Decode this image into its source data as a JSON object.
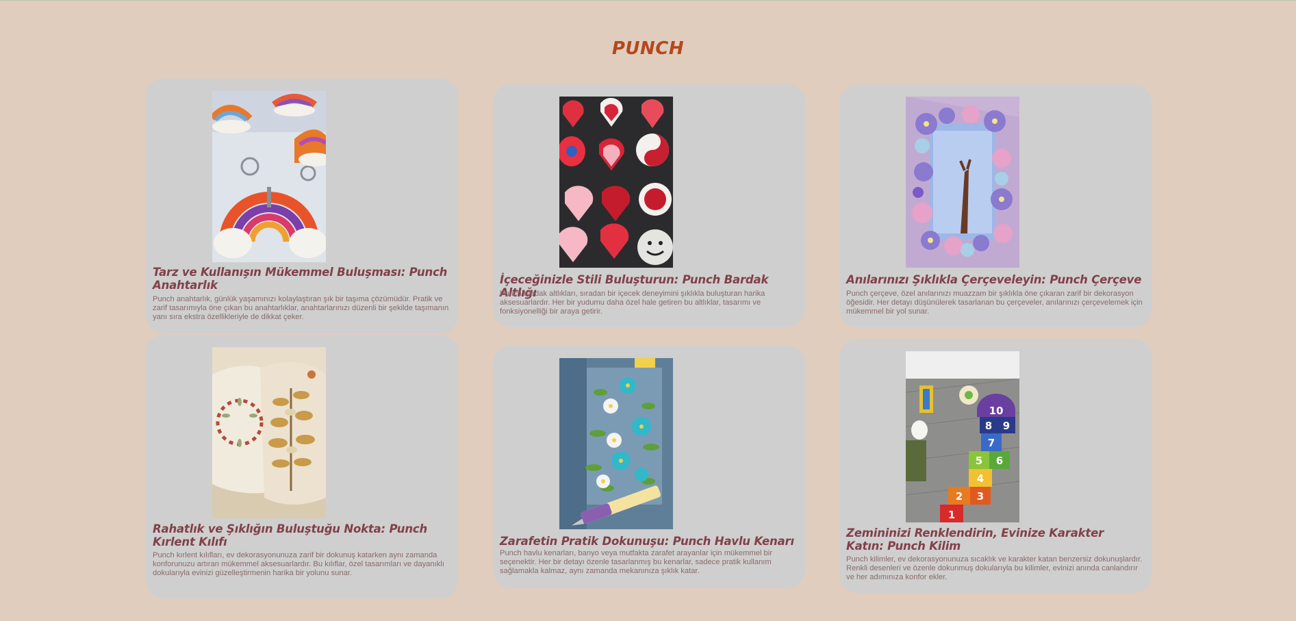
{
  "page": {
    "title": "PUNCH"
  },
  "cards": [
    {
      "title": "Tarz ve Kullanışın Mükemmel Buluşması: Punch Anahtarlık",
      "text": "Punch anahtarlık, günlük yaşamınızı kolaylaştıran şık bir taşıma çözümüdür. Pratik ve zarif tasarımıyla öne çıkan bu anahtarlıklar, anahtarlarınızı düzenli bir şekilde taşımanın yanı sıra ekstra özellikleriyle de dikkat çeker.",
      "image": "rainbow-keychain-photo"
    },
    {
      "title": "İçeceğinizle Stili Buluşturun: Punch Bardak Altlığı",
      "text": "Punch bardak altlıkları, sıradan bir içecek deneyimini şıklıkla buluşturan harika aksesuarlardır. Her bir yudumu daha özel hale getiren bu altlıklar, tasarımı ve fonksiyonelliği bir araya getirir.",
      "image": "heart-coasters-photo"
    },
    {
      "title": "Anılarınızı Şıklıkla Çerçeveleyin: Punch Çerçeve",
      "text": "Punch çerçeve, özel anılarınızı muazzam bir şıklıkla öne çıkaran zarif bir dekorasyon öğesidir. Her detayı düşünülerek tasarlanan bu çerçeveler, anılarınızı çerçevelemek için mükemmel bir yol sunar.",
      "image": "flower-mirror-frame-photo"
    },
    {
      "title": "Rahatlık ve Şıklığın Buluştuğu Nokta: Punch Kırlent Kılıfı",
      "text": "Punch kırlent kılıfları, ev dekorasyonunuza zarif bir dokunuş katarken aynı zamanda konforunuzu artıran mükemmel aksesuarlardır. Bu kılıflar, özel tasarımları ve dayanıklı dokularıyla evinizi güzelleştirmenin harika bir yolunu sunar.",
      "image": "embroidered-pillow-photo"
    },
    {
      "title": "Zarafetin Pratik Dokunuşu: Punch Havlu Kenarı",
      "text": "Punch havlu kenarları, banyo veya mutfakta zarafet arayanlar için mükemmel bir seçenektir. Her bir detayı özenle tasarlanmış bu kenarlar, sadece pratik kullanım sağlamakla kalmaz, aynı zamanda mekanınıza şıklık katar.",
      "image": "flower-towel-border-photo"
    },
    {
      "title": "Zemininizi Renklendirin, Evinize Karakter Katın: Punch Kilim",
      "text": "Punch kilimler, ev dekorasyonunuza sıcaklık ve karakter katan benzersiz dokunuşlardır. Renkli desenleri ve özenle dokunmuş dokularıyla bu kilimler, evinizi anında canlandırır ve her adımınıza konfor ekler.",
      "image": "hopscotch-rug-photo"
    }
  ],
  "hopscotch_numbers": [
    "10",
    "8",
    "9",
    "7",
    "5",
    "6",
    "4",
    "2",
    "3",
    "1"
  ],
  "colors": {
    "background": "#e0cdbd",
    "card": "#cfcfcf",
    "page_title": "#b5481c",
    "card_title": "#82404a",
    "card_text": "#8a6a6a"
  }
}
